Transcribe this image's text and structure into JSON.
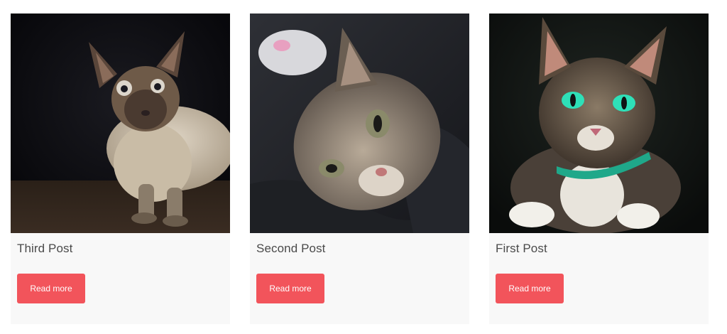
{
  "posts": [
    {
      "title": "Third Post",
      "button_label": "Read more",
      "image_alt": "Cat photo"
    },
    {
      "title": "Second Post",
      "button_label": "Read more",
      "image_alt": "Cat photo"
    },
    {
      "title": "First Post",
      "button_label": "Read more",
      "image_alt": "Cat photo"
    }
  ],
  "colors": {
    "button_bg": "#f2545b",
    "button_text": "#ffffff",
    "card_bg": "#f8f8f8",
    "title_text": "#4a4a4a"
  }
}
